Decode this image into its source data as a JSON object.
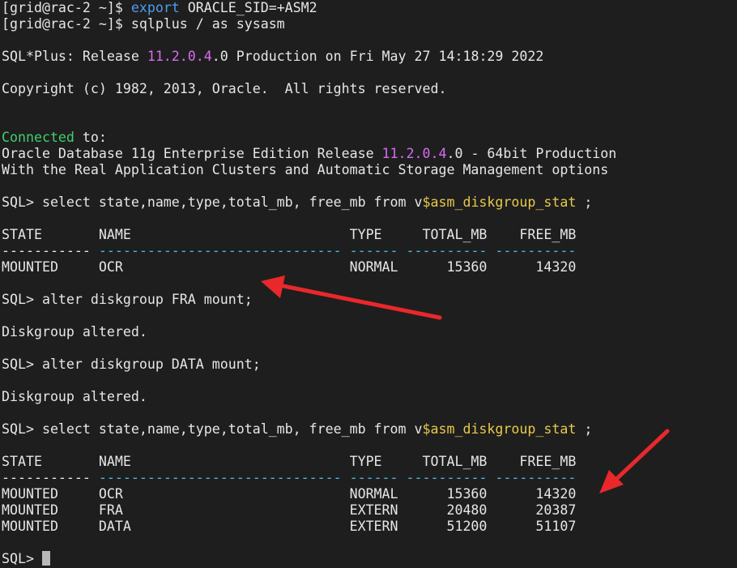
{
  "lines": {
    "l1": {
      "prompt": "[grid@rac-2 ~]$ ",
      "cmd": "export",
      "rest": " ORACLE_SID=+ASM2"
    },
    "l2": {
      "prompt": "[grid@rac-2 ~]$ ",
      "rest": "sqlplus / as sysasm"
    },
    "l3": {
      "a": "SQL*Plus: Release ",
      "ver": "11.2.0.4",
      "b": ".0 Production on Fri May 27 14:18:29 2022"
    },
    "l4": "Copyright (c) 1982, 2013, Oracle.  All rights reserved.",
    "l5": {
      "a": "Connected",
      "b": " to:"
    },
    "l6": {
      "a": "Oracle Database 11g Enterprise Edition Release ",
      "ver": "11.2.0.4",
      "b": ".0 - 64bit Production"
    },
    "l7": "With the Real Application Clusters and Automatic Storage Management options",
    "q1": {
      "a": "SQL> select state,name,type,total_mb, free_mb from v",
      "view": "$asm_diskgroup_stat",
      "b": " ;"
    },
    "h1": "STATE       NAME                           TYPE     TOTAL_MB    FREE_MB",
    "d1": {
      "a": "----------- ",
      "b": "------------------------------ ------ ---------- ----------"
    },
    "r1": "MOUNTED     OCR                            NORMAL      15360      14320",
    "c2": "SQL> alter diskgroup FRA mount;",
    "a2": "Diskgroup altered.",
    "c3": "SQL> alter diskgroup DATA mount;",
    "a3": "Diskgroup altered.",
    "q2": {
      "a": "SQL> select state,name,type,total_mb, free_mb from v",
      "view": "$asm_diskgroup_stat",
      "b": " ;"
    },
    "h2": "STATE       NAME                           TYPE     TOTAL_MB    FREE_MB",
    "d2": {
      "a": "----------- ",
      "b": "------------------------------ ------ ---------- ----------"
    },
    "r2": "MOUNTED     OCR                            NORMAL      15360      14320",
    "r3": "MOUNTED     FRA                            EXTERN      20480      20387",
    "r4": "MOUNTED     DATA                           EXTERN      51200      51107",
    "prompt": "SQL> "
  },
  "colors": {
    "background": "#1e1e1e",
    "text": "#e6e6e6",
    "command": "#4f9cf0",
    "version": "#d86cf0",
    "connected": "#3fd06c",
    "view_name": "#e8c94a",
    "dashes": "#4fb8e8",
    "arrow": "#e8282b"
  },
  "icons": [
    "red-arrow-icon",
    "red-arrow-icon"
  ]
}
